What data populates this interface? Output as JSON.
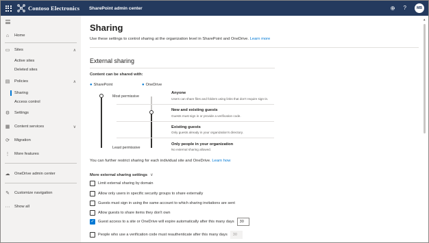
{
  "topbar": {
    "brand": "Contoso Electronics",
    "app_name": "SharePoint admin center",
    "avatar_initials": "MB",
    "icons": [
      "waffle-icon",
      "gear-icon",
      "help-icon"
    ],
    "bg_color": "#243a5e"
  },
  "nav": {
    "items": [
      {
        "label": "Home",
        "icon": "home-icon"
      },
      {
        "label": "Sites",
        "icon": "sites-icon",
        "expanded": true
      },
      {
        "label": "Active sites"
      },
      {
        "label": "Deleted sites"
      },
      {
        "label": "Policies",
        "icon": "policies-icon",
        "expanded": true
      },
      {
        "label": "Sharing",
        "active": true
      },
      {
        "label": "Access control"
      },
      {
        "label": "Settings",
        "icon": "gear-icon"
      },
      {
        "label": "Content services",
        "icon": "content-services-icon",
        "expanded": false
      },
      {
        "label": "Migration",
        "icon": "migration-icon"
      },
      {
        "label": "More features",
        "icon": "more-features-icon"
      },
      {
        "label": "OneDrive admin center",
        "icon": "onedrive-icon"
      },
      {
        "label": "Customize navigation",
        "icon": "edit-icon"
      },
      {
        "label": "Show all",
        "icon": "ellipsis-icon"
      }
    ]
  },
  "main": {
    "title": "Sharing",
    "intro": "Use these settings to control sharing at the organization level in SharePoint and OneDrive.",
    "intro_link": "Learn more",
    "external_sharing": {
      "title": "External sharing",
      "content_label": "Content can be shared with:",
      "col_sharepoint": "SharePoint",
      "col_onedrive": "OneDrive",
      "most_permissive": "Most permissive",
      "least_permissive": "Least permissive",
      "sharepoint_level": "Anyone",
      "onedrive_level": "New and existing guests",
      "levels": [
        {
          "title": "Anyone",
          "desc": "Users can share files and folders using links that don't require sign-in."
        },
        {
          "title": "New and existing guests",
          "desc": "Guests must sign in or provide a verification code."
        },
        {
          "title": "Existing guests",
          "desc": "Only guests already in your organization's directory."
        },
        {
          "title": "Only people in your organization",
          "desc": "No external sharing allowed."
        }
      ],
      "further_text": "You can further restrict sharing for each individual site and OneDrive.",
      "further_link": "Learn how"
    },
    "more_settings": {
      "title": "More external sharing settings",
      "options": [
        {
          "label": "Limit external sharing by domain",
          "checked": false
        },
        {
          "label": "Allow only users in specific security groups to share externally",
          "checked": false
        },
        {
          "label": "Guests must sign in using the same account to which sharing invitations are sent",
          "checked": false
        },
        {
          "label": "Allow guests to share items they don't own",
          "checked": false
        },
        {
          "label": "Guest access to a site or OneDrive will expire automatically after this many days",
          "checked": true,
          "value": "30"
        },
        {
          "label": "People who use a verification code must reauthenticate after this many days",
          "checked": false,
          "value": "30"
        }
      ]
    },
    "accent_color": "#0078d4"
  }
}
